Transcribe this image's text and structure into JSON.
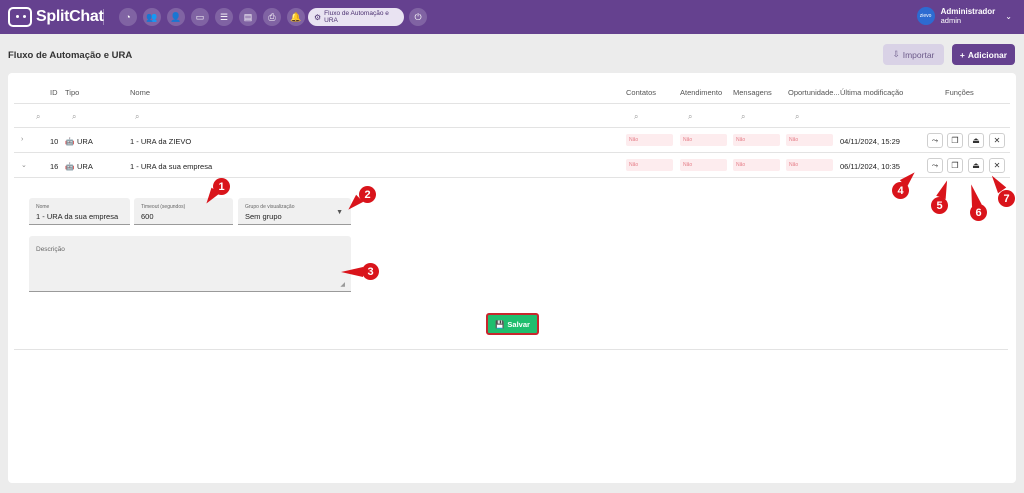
{
  "app": {
    "logo_text": "SplitChat",
    "active_tab_label": "Fluxo de Automação e URA"
  },
  "user": {
    "avatar_text": "zievo",
    "name": "Administrador",
    "role": "admin"
  },
  "nav_icons": [
    "dashboard-icon",
    "contacts-icon",
    "user-config-icon",
    "chat-icon",
    "list-icon",
    "document-icon",
    "print-icon",
    "bell-icon",
    "gear-icon",
    "power-icon"
  ],
  "page": {
    "title": "Fluxo de Automação e URA",
    "import_label": "Importar",
    "add_label": "Adicionar"
  },
  "table": {
    "headers": {
      "id": "ID",
      "tipo": "Tipo",
      "nome": "Nome",
      "contatos": "Contatos",
      "atendimento": "Atendimento",
      "mensagens": "Mensagens",
      "oportunidade": "Oportunidade...",
      "ultima": "Última modificação",
      "funcoes": "Funções"
    },
    "rows": [
      {
        "id": "10",
        "tipo": "URA",
        "nome": "1 - URA da ZIEVO",
        "contatos": "Não",
        "atendimento": "Não",
        "mensagens": "Não",
        "oportunidade": "Não",
        "ultima": "04/11/2024, 15:29"
      },
      {
        "id": "16",
        "tipo": "URA",
        "nome": "1 - URA da sua empresa",
        "contatos": "Não",
        "atendimento": "Não",
        "mensagens": "Não",
        "oportunidade": "Não",
        "ultima": "06/11/2024, 10:35"
      }
    ]
  },
  "detail": {
    "nome_label": "Nome",
    "nome_value": "1 - URA da sua empresa",
    "timeout_label": "Timeout (segundos)",
    "timeout_value": "600",
    "grupo_label": "Grupo de visualização",
    "grupo_value": "Sem grupo",
    "descricao_label": "Descrição",
    "save_label": "Salvar"
  },
  "callouts": [
    "1",
    "2",
    "3",
    "4",
    "5",
    "6",
    "7"
  ]
}
